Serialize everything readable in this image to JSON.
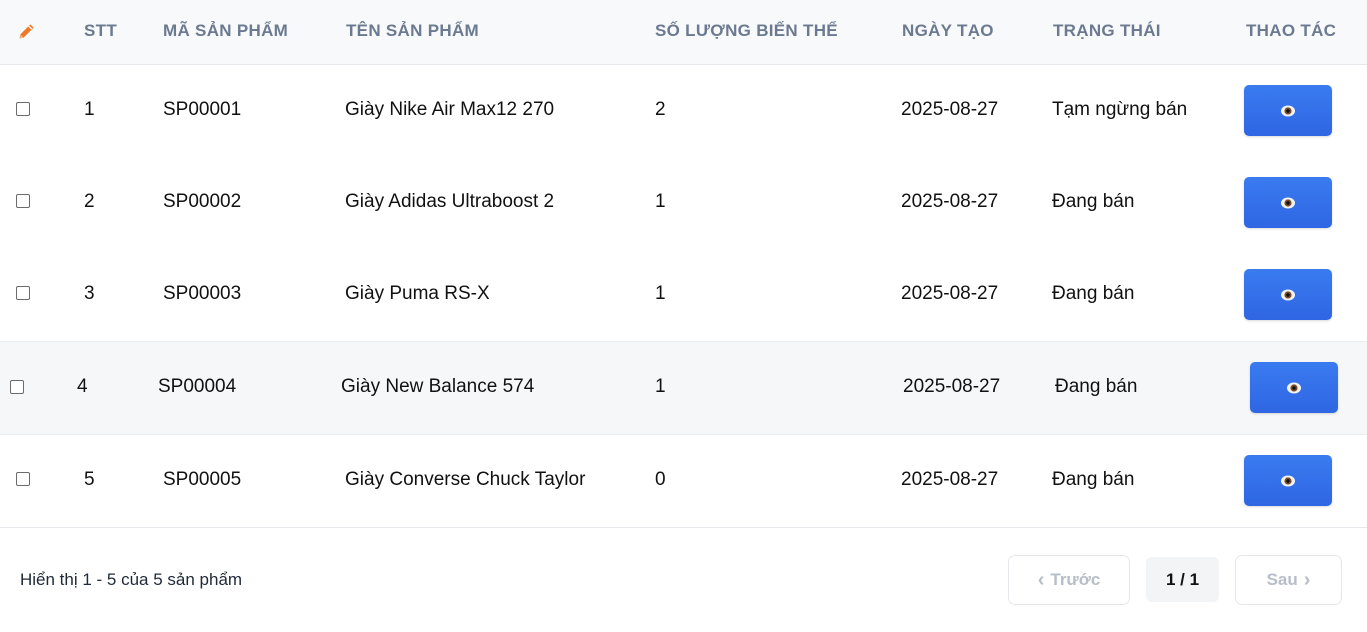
{
  "table": {
    "headers": {
      "stt": "STT",
      "code": "MÃ SẢN PHẨM",
      "name": "TÊN SẢN PHẨM",
      "variants": "SỐ LƯỢNG BIẾN THỂ",
      "created": "NGÀY TẠO",
      "status": "TRẠNG THÁI",
      "actions": "THAO TÁC"
    },
    "rows": [
      {
        "stt": "1",
        "code": "SP00001",
        "name": "Giày Nike Air Max12 270",
        "variants": "2",
        "created": "2025-08-27",
        "status": "Tạm ngừng bán"
      },
      {
        "stt": "2",
        "code": "SP00002",
        "name": "Giày Adidas Ultraboost 2",
        "variants": "1",
        "created": "2025-08-27",
        "status": "Đang bán"
      },
      {
        "stt": "3",
        "code": "SP00003",
        "name": "Giày Puma RS-X",
        "variants": "1",
        "created": "2025-08-27",
        "status": "Đang bán"
      },
      {
        "stt": "4",
        "code": "SP00004",
        "name": "Giày New Balance 574",
        "variants": "1",
        "created": "2025-08-27",
        "status": "Đang bán"
      },
      {
        "stt": "5",
        "code": "SP00005",
        "name": "Giày Converse Chuck Taylor",
        "variants": "0",
        "created": "2025-08-27",
        "status": "Đang bán"
      }
    ]
  },
  "footer": {
    "summary": "Hiển thị 1 - 5 của 5 sản phẩm",
    "prev_label": "Trước",
    "page": "1 / 1",
    "next_label": "Sau"
  },
  "icons": {
    "header": "pencil-icon",
    "action": "eye-icon",
    "prev": "chevron-left-icon",
    "next": "chevron-right-icon"
  },
  "colors": {
    "accent": "#2f66e3",
    "pencil": "#f07a2a",
    "header_text": "#6b7a90"
  }
}
